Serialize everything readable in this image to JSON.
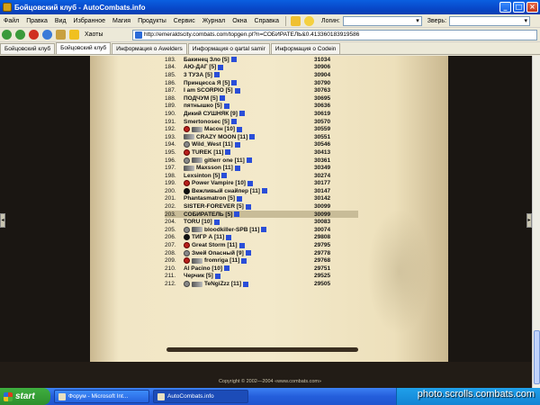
{
  "window": {
    "title": "Бойцовский клуб - AutoCombats.info"
  },
  "menu": {
    "items": [
      "Файл",
      "Правка",
      "Вид",
      "Избранное",
      "Магия",
      "Продукты",
      "Сервис",
      "Журнал",
      "Окна",
      "Справка"
    ],
    "login_label": "Логин:",
    "pet_label": "Зверь:"
  },
  "nav": {
    "bookmarks_label": "Хаоты",
    "url": "http://emeraldscity.combats.com/topgen.pl?n=СОБИРАТЕЛЬ&0.413360183919586"
  },
  "tabs": [
    {
      "label": "Бойцовский клуб",
      "active": false
    },
    {
      "label": "Бойцовский клуб",
      "active": true
    },
    {
      "label": "Информация о Awelders",
      "active": false
    },
    {
      "label": "Информация о qartal samir",
      "active": false
    },
    {
      "label": "Информация о Codein",
      "active": false
    }
  ],
  "ranking": [
    {
      "rank": "183.",
      "name": "Бакинец Зло [5]",
      "score": "31034",
      "clan": "",
      "info": true
    },
    {
      "rank": "184.",
      "name": "АЮ-ДАГ [5]",
      "score": "30906",
      "clan": "",
      "info": true
    },
    {
      "rank": "185.",
      "name": "3 ТУЗА [5]",
      "score": "30904",
      "clan": "",
      "info": true
    },
    {
      "rank": "186.",
      "name": "Принцесса Я [5]",
      "score": "30790",
      "clan": "",
      "info": true
    },
    {
      "rank": "187.",
      "name": "I am SCORPIO [5]",
      "score": "30763",
      "clan": "",
      "info": true
    },
    {
      "rank": "188.",
      "name": "ПОДЧУМ [5]",
      "score": "30695",
      "clan": "",
      "info": true
    },
    {
      "rank": "189.",
      "name": "пятнышко [5]",
      "score": "30636",
      "clan": "",
      "info": true
    },
    {
      "rank": "190.",
      "name": "Дикий СУШНЯК [9]",
      "score": "30619",
      "clan": "",
      "info": true
    },
    {
      "rank": "191.",
      "name": "Smertonosec [5]",
      "score": "30570",
      "clan": "",
      "info": true
    },
    {
      "rank": "192.",
      "name": "Масон [10]",
      "score": "30559",
      "clan": "red-wing",
      "info": true
    },
    {
      "rank": "193.",
      "name": "CRAZY MOON [11]",
      "score": "30551",
      "clan": "wing",
      "info": true
    },
    {
      "rank": "194.",
      "name": "Wild_West [11]",
      "score": "30546",
      "clan": "gray",
      "info": true
    },
    {
      "rank": "195.",
      "name": "TUREK [11]",
      "score": "30413",
      "clan": "red",
      "info": true
    },
    {
      "rank": "196.",
      "name": "gitlerr one [11]",
      "score": "30361",
      "clan": "gray-wing",
      "info": true
    },
    {
      "rank": "197.",
      "name": "Maxsson [11]",
      "score": "30349",
      "clan": "wing",
      "info": true
    },
    {
      "rank": "198.",
      "name": "Lexsinton [5]",
      "score": "30274",
      "clan": "",
      "info": true
    },
    {
      "rank": "199.",
      "name": "Power Vampire [10]",
      "score": "30177",
      "clan": "red",
      "info": true
    },
    {
      "rank": "200.",
      "name": "Вежливый снайпер [11]",
      "score": "30147",
      "clan": "black",
      "info": true
    },
    {
      "rank": "201.",
      "name": "Phantasmatron [5]",
      "score": "30142",
      "clan": "",
      "info": true
    },
    {
      "rank": "202.",
      "name": "SISTER-FOREVER [5]",
      "score": "30099",
      "clan": "",
      "info": true
    },
    {
      "rank": "203.",
      "name": "СОБИРАТЕЛЬ [5]",
      "score": "30099",
      "clan": "",
      "info": true
    },
    {
      "rank": "204.",
      "name": "TORU [10]",
      "score": "30083",
      "clan": "",
      "info": true
    },
    {
      "rank": "205.",
      "name": "bloodkiller-SPB [11]",
      "score": "30074",
      "clan": "gray-wing",
      "info": true
    },
    {
      "rank": "206.",
      "name": "ТИГР А [11]",
      "score": "29808",
      "clan": "black",
      "info": true
    },
    {
      "rank": "207.",
      "name": "Great Storm [11]",
      "score": "29795",
      "clan": "red",
      "info": true
    },
    {
      "rank": "208.",
      "name": "Змей Опасный [9]",
      "score": "29778",
      "clan": "gray",
      "info": true
    },
    {
      "rank": "209.",
      "name": "fromriga [11]",
      "score": "29768",
      "clan": "red-wing",
      "info": true
    },
    {
      "rank": "210.",
      "name": "Al Pacino [10]",
      "score": "29751",
      "clan": "",
      "info": true
    },
    {
      "rank": "211.",
      "name": "Черчик [5]",
      "score": "29525",
      "clan": "",
      "info": true
    },
    {
      "rank": "212.",
      "name": "TeNgiZzz [11]",
      "score": "29505",
      "clan": "gray-wing",
      "info": true
    }
  ],
  "highlighted_rank": "203.",
  "footer": {
    "copyright": "Copyright © 2002—2004 «www.combats.com»"
  },
  "taskbar": {
    "start_label": "start",
    "tasks": [
      {
        "label": "Форум - Microsoft Int...",
        "active": false
      },
      {
        "label": "AutoCombats.info",
        "active": true
      }
    ],
    "watermark": "photo.scrolls.combats.com"
  },
  "colors": {
    "titlebar": "#0a5fe0",
    "parchment": "#f1e6c5",
    "highlight_row": "#c8bc98",
    "page_background": "#1a1612"
  }
}
